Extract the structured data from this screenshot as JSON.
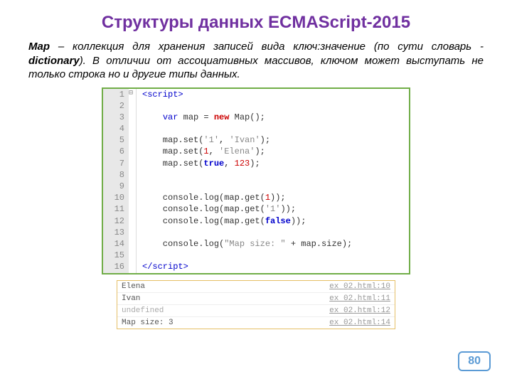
{
  "title": "Структуры данных ECMAScript-2015",
  "desc": {
    "term": "Map",
    "body": " – коллекция для хранения записей вида ключ:значение (по сути словарь - ",
    "term2": "dictionary",
    "body2": "). В отличии от ассоциативных массивов, ключом может выступать не только строка но и другие типы данных."
  },
  "code": {
    "lines": [
      {
        "n": "1",
        "fold": "⊟",
        "html": "<span class='tag'>&lt;script&gt;</span>"
      },
      {
        "n": "2",
        "html": ""
      },
      {
        "n": "3",
        "html": "    <span class='kw'>var</span> map = <span class='kw2'>new</span> Map();"
      },
      {
        "n": "4",
        "html": ""
      },
      {
        "n": "5",
        "html": "    map.set(<span class='str'>'1'</span>, <span class='str'>'Ivan'</span>);"
      },
      {
        "n": "6",
        "html": "    map.set(<span class='num'>1</span>, <span class='str'>'Elena'</span>);"
      },
      {
        "n": "7",
        "html": "    map.set(<span class='boolw'>true</span>, <span class='num'>123</span>);"
      },
      {
        "n": "8",
        "html": ""
      },
      {
        "n": "9",
        "html": ""
      },
      {
        "n": "10",
        "html": "    console.log(map.get(<span class='num'>1</span>));"
      },
      {
        "n": "11",
        "html": "    console.log(map.get(<span class='str'>'1'</span>));"
      },
      {
        "n": "12",
        "html": "    console.log(map.get(<span class='boolw'>false</span>));"
      },
      {
        "n": "13",
        "html": ""
      },
      {
        "n": "14",
        "html": "    console.log(<span class='str'>\"Map size: \"</span> + map.size);"
      },
      {
        "n": "15",
        "html": ""
      },
      {
        "n": "16",
        "html": "<span class='tag'>&lt;/script&gt;</span>"
      }
    ]
  },
  "console": [
    {
      "out": "Elena",
      "src": "ex 02.html:10"
    },
    {
      "out": "Ivan",
      "src": "ex 02.html:11"
    },
    {
      "out": "undefined",
      "src": "ex 02.html:12",
      "undef": true
    },
    {
      "out": "Map size: 3",
      "src": "ex 02.html:14"
    }
  ],
  "page": "80"
}
